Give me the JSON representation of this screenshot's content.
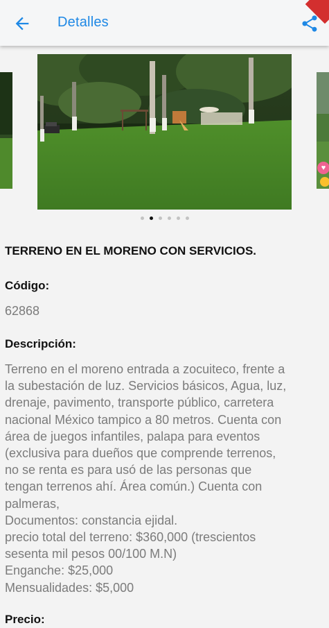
{
  "appbar": {
    "title": "Detalles",
    "back_icon": "arrow-back-icon",
    "share_icon": "share-icon",
    "accent_color": "#1e88e5"
  },
  "carousel": {
    "slide_count": 6,
    "active_index": 1
  },
  "listing": {
    "title": "TERRENO EN EL MORENO CON SERVICIOS.",
    "code_label": "Código:",
    "code_value": "62868",
    "description_label": "Descripción:",
    "description_lines": [
      "Terreno en el moreno entrada a zocuiteco, frente a",
      "la subestación de luz. Servicios básicos, Agua, luz,",
      "drenaje, pavimento,  transporte público, carretera",
      "nacional México tampico a 80 metros.  Cuenta con",
      "área de juegos infantiles, palapa para eventos",
      "(exclusiva para dueños que comprende terrenos,",
      "no se renta es para usó de las personas que",
      "tengan terrenos ahí. Área común.) Cuenta con",
      "palmeras,",
      "Documentos: constancia ejidal.",
      "precio total del terreno: $360,000 (trescientos",
      "sesenta mil pesos 00/100 M.N)",
      "Enganche: $25,000",
      "Mensualidades: $5,000"
    ],
    "price_label": "Precio:"
  }
}
